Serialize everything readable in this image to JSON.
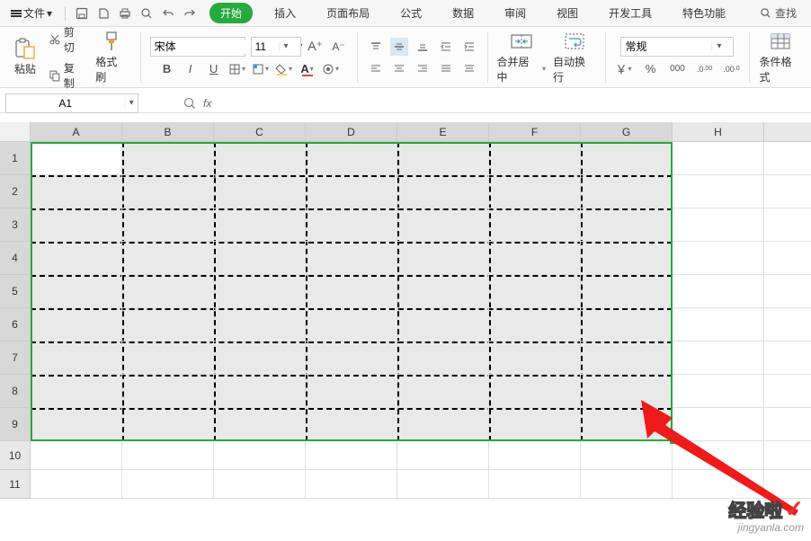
{
  "menu": {
    "file_label": "文件",
    "tabs": [
      "开始",
      "插入",
      "页面布局",
      "公式",
      "数据",
      "审阅",
      "视图",
      "开发工具",
      "特色功能"
    ],
    "find_label": "查找"
  },
  "ribbon": {
    "paste_label": "粘贴",
    "cut_label": "剪切",
    "copy_label": "复制",
    "format_painter_label": "格式刷",
    "font_name": "宋体",
    "font_size": "11",
    "merge_label": "合并居中",
    "wrap_label": "自动换行",
    "number_format": "常规",
    "cond_format_label": "条件格式",
    "bold": "B",
    "italic": "I",
    "underline": "U",
    "currency": "￥",
    "percent": "%",
    "thousands": "000",
    "inc_dec": ".0",
    "dec_dec": ".00"
  },
  "namebox": {
    "value": "A1"
  },
  "formula": {
    "fx": "fx",
    "value": ""
  },
  "sheet": {
    "columns": [
      "A",
      "B",
      "C",
      "D",
      "E",
      "F",
      "G",
      "H"
    ],
    "rows": [
      "1",
      "2",
      "3",
      "4",
      "5",
      "6",
      "7",
      "8",
      "9",
      "10",
      "11"
    ],
    "selected_cols": 7,
    "selected_rows": 9
  },
  "watermark": {
    "name": "经验啦",
    "url": "jingyanla.com"
  }
}
